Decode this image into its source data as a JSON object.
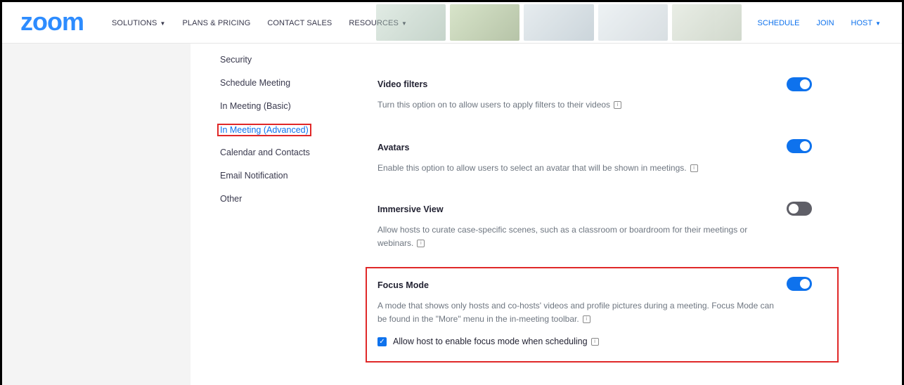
{
  "header": {
    "logo": "zoom",
    "nav": [
      {
        "label": "SOLUTIONS",
        "has_caret": true
      },
      {
        "label": "PLANS & PRICING",
        "has_caret": false
      },
      {
        "label": "CONTACT SALES",
        "has_caret": false
      },
      {
        "label": "RESOURCES",
        "has_caret": true
      }
    ],
    "right_nav": {
      "schedule": "SCHEDULE",
      "join": "JOIN",
      "host": "HOST"
    }
  },
  "subnav": [
    {
      "label": "Security"
    },
    {
      "label": "Schedule Meeting"
    },
    {
      "label": "In Meeting (Basic)"
    },
    {
      "label": "In Meeting (Advanced)",
      "active": true
    },
    {
      "label": "Calendar and Contacts"
    },
    {
      "label": "Email Notification"
    },
    {
      "label": "Other"
    }
  ],
  "settings": [
    {
      "title": "Video filters",
      "description": "Turn this option on to allow users to apply filters to their videos",
      "enabled": true
    },
    {
      "title": "Avatars",
      "description": "Enable this option to allow users to select an avatar that will be shown in meetings.",
      "enabled": true
    },
    {
      "title": "Immersive View",
      "description": "Allow hosts to curate case-specific scenes, such as a classroom or boardroom for their meetings or webinars.",
      "enabled": false
    },
    {
      "title": "Focus Mode",
      "description": "A mode that shows only hosts and co-hosts' videos and profile pictures during a meeting. Focus Mode can be found in the \"More\" menu in the in-meeting toolbar.",
      "enabled": true
    }
  ],
  "focus_option": {
    "label": "Allow host to enable focus mode when scheduling",
    "checked": true
  },
  "colors": {
    "brand": "#2D8CFF",
    "toggle_on": "#0E72ED",
    "toggle_off": "#5f5f67",
    "highlight": "#e02828"
  },
  "icons": {
    "info": "info-icon",
    "caret": "caret-down-icon",
    "check": "checkmark-icon"
  }
}
